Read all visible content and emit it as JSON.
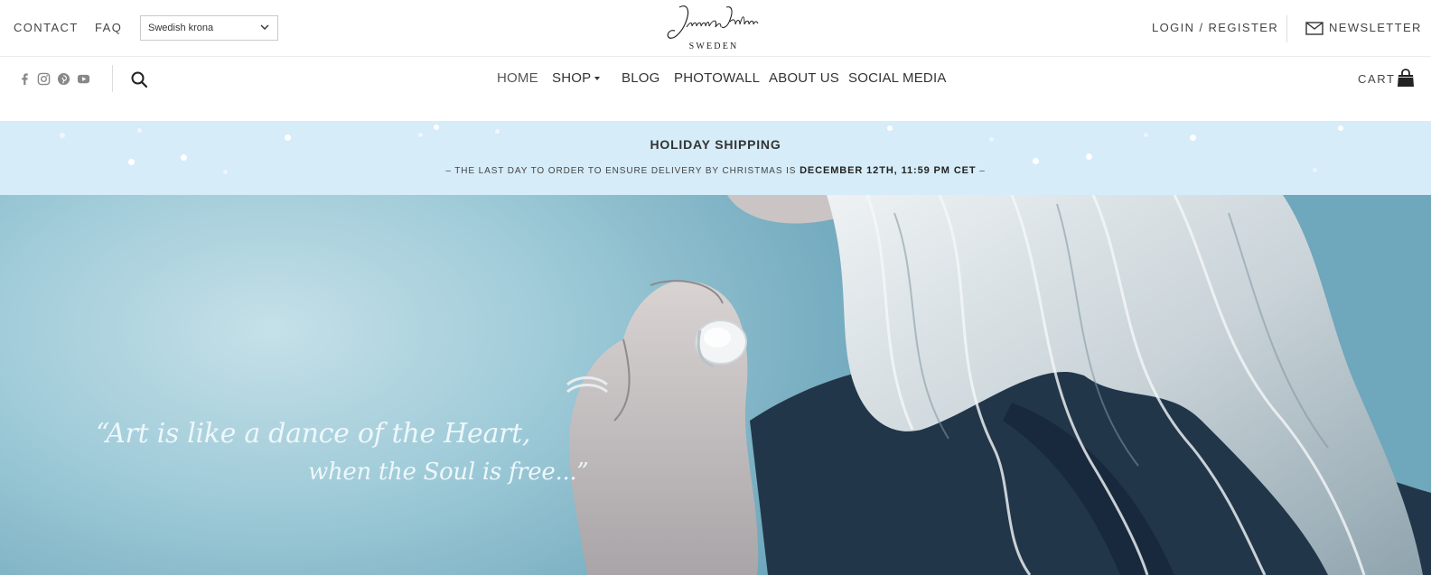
{
  "topbar": {
    "contact": "CONTACT",
    "faq": "FAQ",
    "currency_selected": "Swedish krona",
    "logo_text": "Jonna Jodon",
    "logo_sub": "SWEDEN",
    "login": "LOGIN / REGISTER",
    "newsletter": "NEWSLETTER"
  },
  "social_icons": [
    "facebook-icon",
    "instagram-icon",
    "pinterest-icon",
    "youtube-icon"
  ],
  "nav": {
    "items": [
      {
        "label": "HOME",
        "active": true
      },
      {
        "label": "SHOP",
        "has_dropdown": true
      },
      {
        "label": "BLOG"
      },
      {
        "label": "PHOTOWALL"
      },
      {
        "label": "ABOUT US"
      },
      {
        "label": "SOCIAL MEDIA"
      }
    ],
    "cart": "CART"
  },
  "banner": {
    "title": "HOLIDAY SHIPPING",
    "prefix": "– THE LAST DAY TO ORDER TO ENSURE DELIVERY BY CHRISTMAS IS ",
    "deadline": "DECEMBER 12TH, 11:59 PM CET",
    "suffix": " –",
    "background": "#d6ecf8"
  },
  "hero": {
    "quote_line1": "“Art is like a dance of the Heart,",
    "quote_line2": "when the Soul is free...”"
  }
}
